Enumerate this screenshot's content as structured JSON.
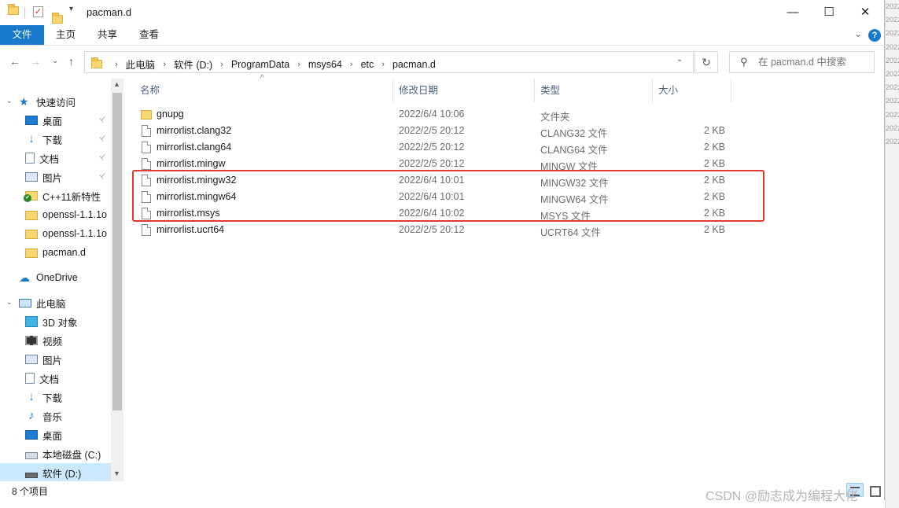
{
  "window": {
    "title": "pacman.d",
    "minimize_glyph": "—",
    "maximize_glyph": "☐",
    "close_glyph": "✕"
  },
  "ribbon": {
    "tabs": [
      "文件",
      "主页",
      "共享",
      "查看"
    ],
    "expand_glyph": "⌄",
    "help_glyph": "?"
  },
  "nav_buttons": {
    "back": "←",
    "forward": "→",
    "recent": "⌄",
    "up": "↑"
  },
  "address": {
    "crumbs": [
      "此电脑",
      "软件 (D:)",
      "ProgramData",
      "msys64",
      "etc",
      "pacman.d"
    ],
    "sep": "›",
    "dropdown": "⌄",
    "refresh": "↻"
  },
  "search": {
    "placeholder": "在 pacman.d 中搜索",
    "icon_glyph": "⚲"
  },
  "navpane": {
    "items": [
      {
        "label": "快速访问",
        "icon": "star-icon"
      },
      {
        "label": "桌面",
        "icon": "desktop-icon",
        "pinned": true
      },
      {
        "label": "下载",
        "icon": "download-icon",
        "pinned": true
      },
      {
        "label": "文档",
        "icon": "document-icon",
        "pinned": true
      },
      {
        "label": "图片",
        "icon": "picture-icon",
        "pinned": true
      },
      {
        "label": "C++11新特性",
        "icon": "folder-sync-icon"
      },
      {
        "label": "openssl-1.1.1o",
        "icon": "folder-icon"
      },
      {
        "label": "openssl-1.1.1o",
        "icon": "folder-icon"
      },
      {
        "label": "pacman.d",
        "icon": "folder-icon"
      },
      {
        "label": "OneDrive",
        "icon": "cloud-icon"
      },
      {
        "label": "此电脑",
        "icon": "computer-icon"
      },
      {
        "label": "3D 对象",
        "icon": "cube-icon"
      },
      {
        "label": "视频",
        "icon": "video-icon"
      },
      {
        "label": "图片",
        "icon": "picture-icon"
      },
      {
        "label": "文档",
        "icon": "document-icon"
      },
      {
        "label": "下载",
        "icon": "download-icon"
      },
      {
        "label": "音乐",
        "icon": "music-icon"
      },
      {
        "label": "桌面",
        "icon": "desktop-icon"
      },
      {
        "label": "本地磁盘 (C:)",
        "icon": "drive-icon"
      },
      {
        "label": "软件 (D:)",
        "icon": "drive-icon",
        "selected": true
      }
    ],
    "pin_glyph": "📌"
  },
  "columns": [
    "名称",
    "修改日期",
    "类型",
    "大小"
  ],
  "sort_glyph": "^",
  "files": [
    {
      "name": "gnupg",
      "date": "2022/6/4 10:06",
      "type": "文件夹",
      "size": "",
      "kind": "folder"
    },
    {
      "name": "mirrorlist.clang32",
      "date": "2022/2/5 20:12",
      "type": "CLANG32 文件",
      "size": "2 KB",
      "kind": "file"
    },
    {
      "name": "mirrorlist.clang64",
      "date": "2022/2/5 20:12",
      "type": "CLANG64 文件",
      "size": "2 KB",
      "kind": "file"
    },
    {
      "name": "mirrorlist.mingw",
      "date": "2022/2/5 20:12",
      "type": "MINGW 文件",
      "size": "2 KB",
      "kind": "file"
    },
    {
      "name": "mirrorlist.mingw32",
      "date": "2022/6/4 10:01",
      "type": "MINGW32 文件",
      "size": "2 KB",
      "kind": "file"
    },
    {
      "name": "mirrorlist.mingw64",
      "date": "2022/6/4 10:01",
      "type": "MINGW64 文件",
      "size": "2 KB",
      "kind": "file"
    },
    {
      "name": "mirrorlist.msys",
      "date": "2022/6/4 10:02",
      "type": "MSYS 文件",
      "size": "2 KB",
      "kind": "file"
    },
    {
      "name": "mirrorlist.ucrt64",
      "date": "2022/2/5 20:12",
      "type": "UCRT64 文件",
      "size": "2 KB",
      "kind": "file"
    }
  ],
  "status": {
    "count": "8 个项目"
  },
  "watermark": "CSDN @励志成为编程大佬",
  "backdrop_fragments": [
    "2022",
    "2022",
    "2022",
    "2022",
    "2022",
    "2022",
    "2022",
    "2022",
    "2022",
    "2022",
    "2022"
  ],
  "colors": {
    "accent": "#1979ca",
    "highlight_border": "#e23a33",
    "selection": "#cce8ff"
  }
}
